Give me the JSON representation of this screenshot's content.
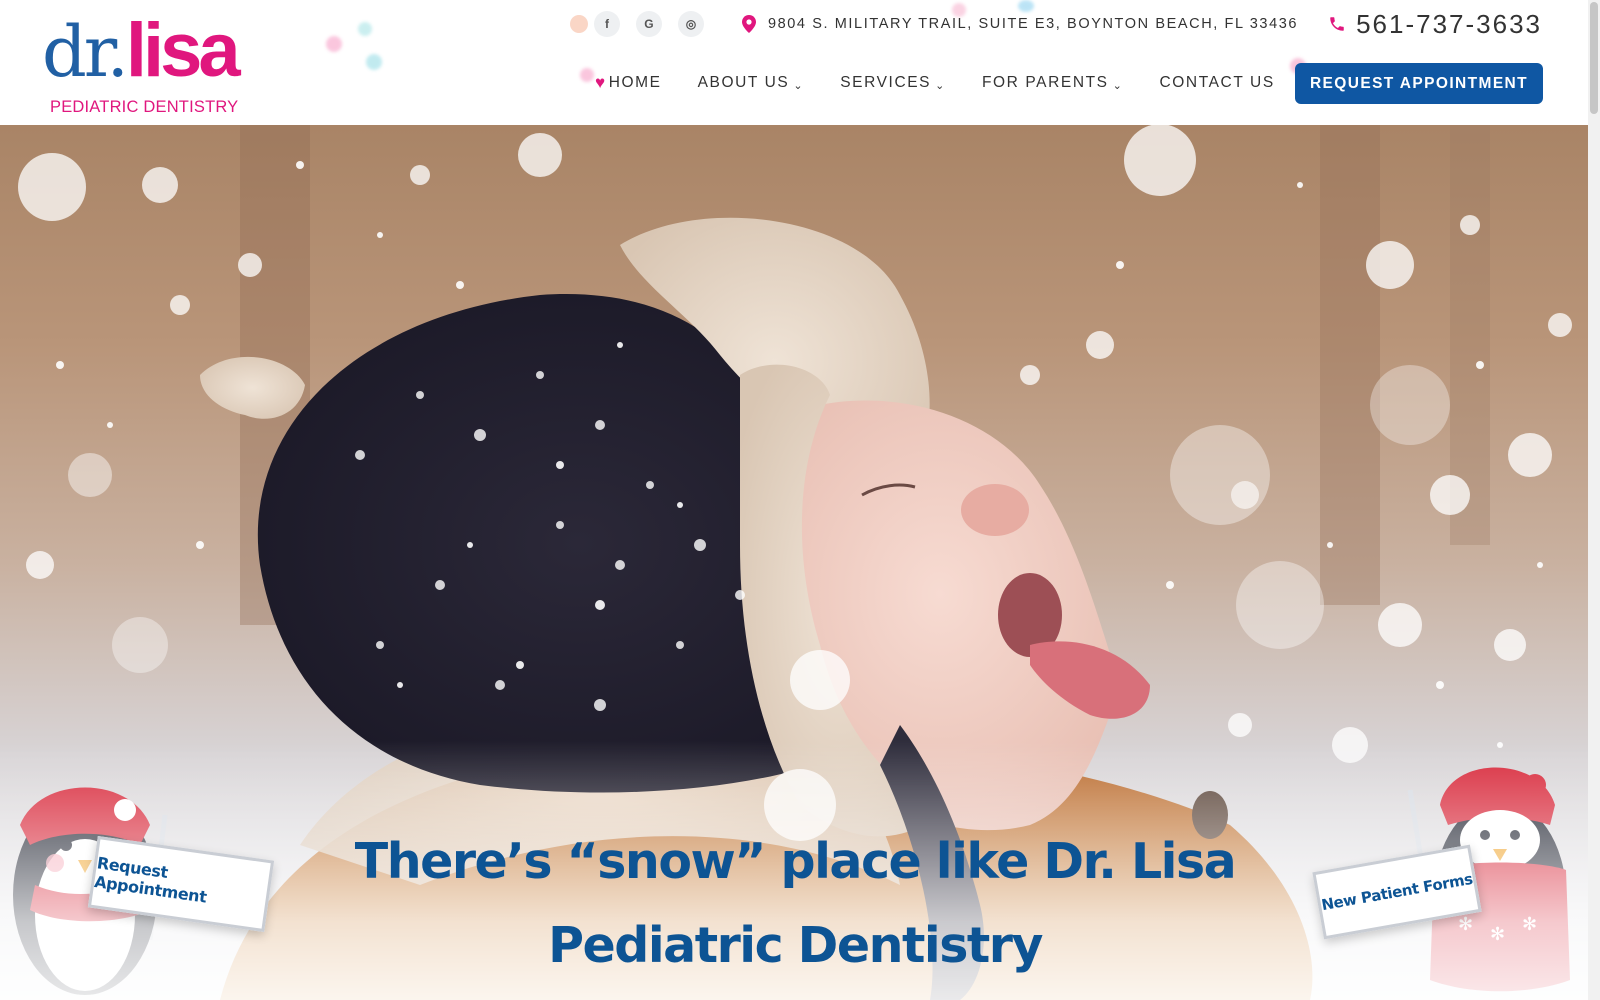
{
  "brand": {
    "logo_dr": "dr.",
    "logo_lisa": "lisa",
    "logo_sub": "PEDIATRIC DENTISTRY"
  },
  "topbar": {
    "social": [
      {
        "icon": "facebook-icon",
        "glyph": "f"
      },
      {
        "icon": "google-icon",
        "glyph": "G"
      },
      {
        "icon": "instagram-icon",
        "glyph": "◎"
      }
    ],
    "address": "9804 S. MILITARY TRAIL, SUITE E3, BOYNTON BEACH, FL 33436",
    "phone": "561-737-3633"
  },
  "nav": {
    "items": [
      {
        "label": "HOME",
        "dropdown": false
      },
      {
        "label": "ABOUT US",
        "dropdown": true
      },
      {
        "label": "SERVICES",
        "dropdown": true
      },
      {
        "label": "FOR PARENTS",
        "dropdown": true
      },
      {
        "label": "CONTACT US",
        "dropdown": false
      }
    ],
    "cta": "REQUEST APPOINTMENT"
  },
  "hero": {
    "headline_line1": "There’s “snow” place like Dr. Lisa",
    "headline_line2": "Pediatric Dentistry",
    "sign_left": "Request Appointment",
    "sign_right": "New Patient Forms"
  },
  "colors": {
    "brand_blue": "#0f57a3",
    "brand_pink": "#e0177e",
    "headline_blue": "#0d5494"
  }
}
